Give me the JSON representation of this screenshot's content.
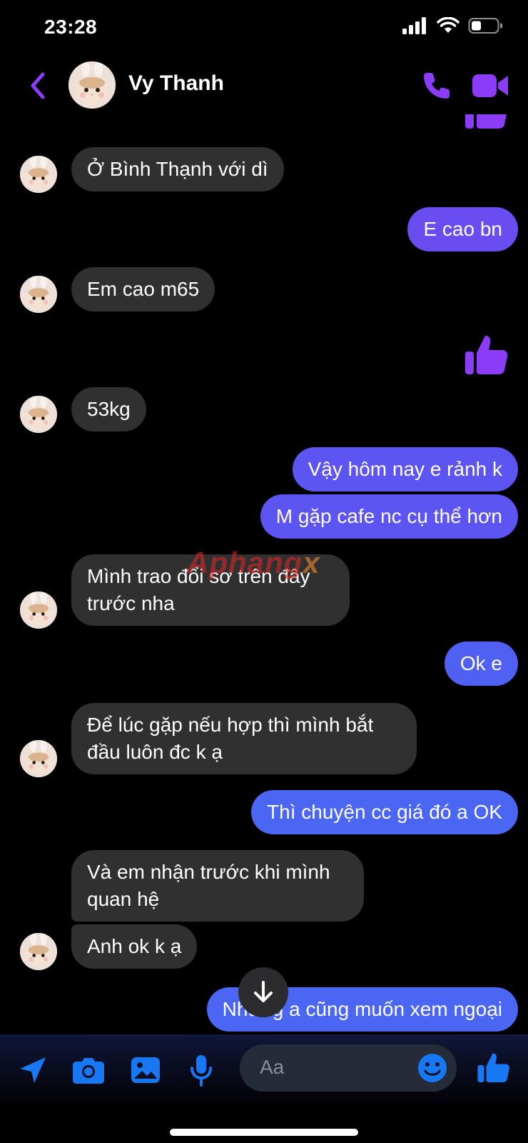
{
  "status_bar": {
    "time": "23:28"
  },
  "header": {
    "contact_name": "Vy Thanh"
  },
  "messages": [
    {
      "from": "contact",
      "text": "Ở Bình Thạnh với dì"
    },
    {
      "from": "me",
      "text": "E cao bn"
    },
    {
      "from": "contact",
      "text": "Em cao m65"
    },
    {
      "from": "me",
      "type": "like"
    },
    {
      "from": "contact",
      "text": "53kg"
    },
    {
      "from": "me",
      "text": "Vậy hôm nay e rảnh k"
    },
    {
      "from": "me",
      "text": "M gặp cafe nc cụ thể hơn"
    },
    {
      "from": "contact",
      "line1": "Mình trao đổi sơ trên đây",
      "line2": "trước nha"
    },
    {
      "from": "me",
      "text": "Ok e"
    },
    {
      "from": "contact",
      "line1": "Để lúc gặp nếu hợp thì mình bắt",
      "line2": "đầu luôn đc k ạ"
    },
    {
      "from": "me",
      "text": "Thì chuyện cc giá đó a OK"
    },
    {
      "from": "contact",
      "line1": "Và em nhận trước khi mình",
      "line2": "quan hệ"
    },
    {
      "from": "contact",
      "text": "Anh ok k ạ"
    },
    {
      "from": "me",
      "text": "Nhưng a cũng muốn xem ngoại"
    }
  ],
  "watermark": {
    "main": "Aphang",
    "suffix": "x"
  },
  "composer": {
    "placeholder": "Aa"
  },
  "colors": {
    "accent": "#8b3cf7",
    "sent_bubble": "#5b56ee",
    "received_bubble": "#303030"
  }
}
